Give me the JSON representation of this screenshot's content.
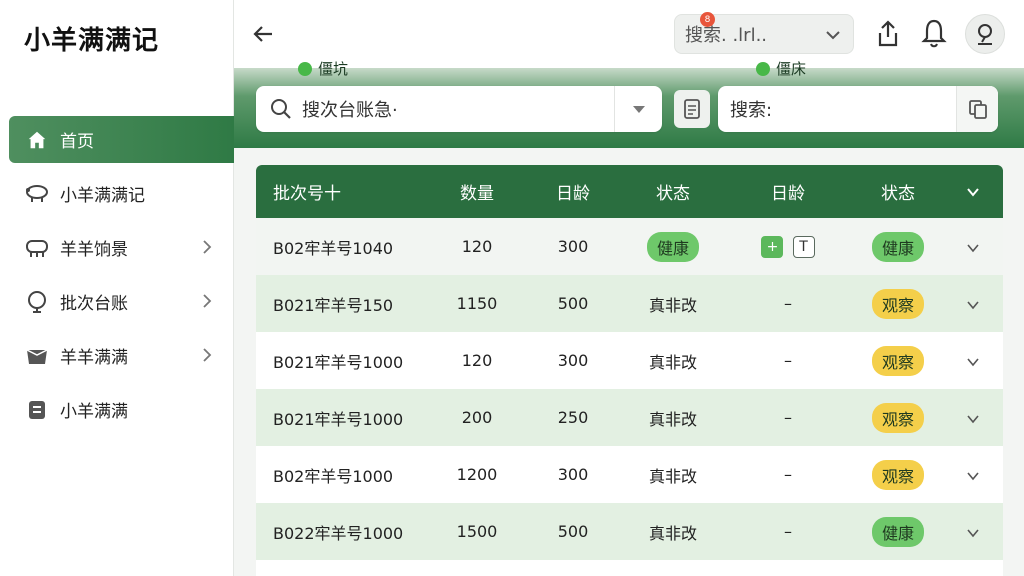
{
  "sidebar": {
    "brand": "小羊满满记",
    "items": [
      {
        "label": "首页",
        "icon": "home-icon",
        "active": true
      },
      {
        "label": "小羊满满记",
        "icon": "sheep-icon"
      },
      {
        "label": "羊羊饷景",
        "icon": "sheep-group-icon",
        "chevron": true
      },
      {
        "label": "批次台账",
        "icon": "ledger-icon",
        "chevron": true
      },
      {
        "label": "羊羊满满",
        "icon": "box-icon",
        "chevron": true
      },
      {
        "label": "小羊满满",
        "icon": "list-icon"
      }
    ]
  },
  "topbar": {
    "search_text": "搜索. .lrl..",
    "notification_count": "8"
  },
  "banner": {
    "left_label": "僵坑",
    "right_label": "僵床"
  },
  "search": {
    "main_placeholder": "搜次台账急·",
    "second_placeholder": "搜索:"
  },
  "table": {
    "headers": [
      "批次号十",
      "数量",
      "日龄",
      "状态",
      "日龄",
      "状态"
    ],
    "rows": [
      {
        "batch": "B02牢羊号1040",
        "qty": "120",
        "age": "300",
        "status": "健康",
        "status_type": "good",
        "age2": "",
        "actions": true,
        "status2": "健康",
        "status2_type": "good"
      },
      {
        "batch": "B021牢羊号150",
        "qty": "1150",
        "age": "500",
        "status": "真非改",
        "status_type": "text",
        "age2": "–",
        "status2": "观察",
        "status2_type": "watch"
      },
      {
        "batch": "B021牢羊号1000",
        "qty": "120",
        "age": "300",
        "status": "真非改",
        "status_type": "text",
        "age2": "–",
        "status2": "观察",
        "status2_type": "watch"
      },
      {
        "batch": "B021牢羊号1000",
        "qty": "200",
        "age": "250",
        "status": "真非改",
        "status_type": "text",
        "age2": "–",
        "status2": "观察",
        "status2_type": "watch"
      },
      {
        "batch": "B02牢羊号1000",
        "qty": "1200",
        "age": "300",
        "status": "真非改",
        "status_type": "text",
        "age2": "–",
        "status2": "观察",
        "status2_type": "watch"
      },
      {
        "batch": "B022牢羊号1000",
        "qty": "1500",
        "age": "500",
        "status": "真非改",
        "status_type": "text",
        "age2": "–",
        "status2": "健康",
        "status2_type": "good"
      }
    ],
    "action_plus": "+",
    "action_t": "T"
  },
  "colors": {
    "primary": "#2a6e3f",
    "healthy": "#6ec86a",
    "watch": "#f4cf4a",
    "badge": "#e8553b"
  }
}
